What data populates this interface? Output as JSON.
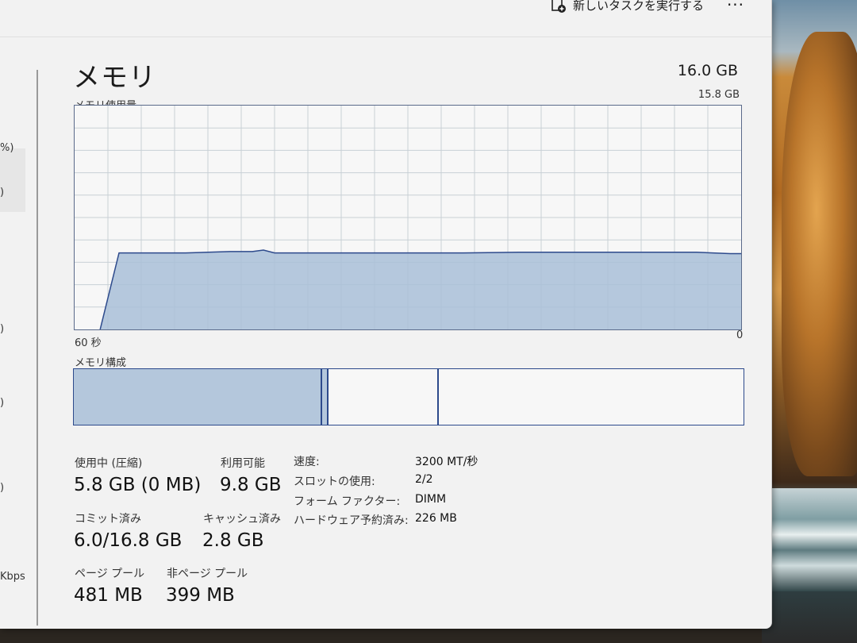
{
  "toolbar": {
    "run_new_task": "新しいタスクを実行する",
    "more_icon": "ellipsis-icon",
    "more_label": "···"
  },
  "sidebar": {
    "fragments": [
      {
        "text": "%)"
      },
      {
        "text": ")"
      },
      {
        "text": ")"
      },
      {
        "text": ")"
      },
      {
        "text": ")"
      },
      {
        "text": "Kbps"
      }
    ]
  },
  "memory": {
    "title": "メモリ",
    "total": "16.0 GB",
    "usage_label": "メモリ使用量",
    "usage_max": "15.8 GB",
    "axis_left": "60 秒",
    "axis_right": "0",
    "composition_label": "メモリ構成"
  },
  "chart_data": {
    "type": "area",
    "x_label_left": "60 秒",
    "x_label_right": "0",
    "ylim": [
      0,
      15.8
    ],
    "grid": true,
    "x": [
      60,
      58,
      57.7,
      56,
      54,
      50,
      46,
      44,
      43,
      42,
      38,
      30,
      25,
      20,
      12,
      10,
      4,
      1,
      0
    ],
    "values": [
      null,
      null,
      0,
      5.4,
      5.4,
      5.4,
      5.5,
      5.5,
      5.6,
      5.4,
      5.4,
      5.4,
      5.4,
      5.45,
      5.45,
      5.45,
      5.45,
      5.35,
      5.35
    ],
    "series": [
      {
        "name": "",
        "values_ref": "values"
      }
    ]
  },
  "composition": {
    "in_use_fraction": 0.37,
    "modified_fraction": 0.007,
    "standby_fraction": 0.163,
    "free_fraction": 0.46
  },
  "stats": {
    "in_use_label": "使用中 (圧縮)",
    "in_use_value": "5.8 GB (0 MB)",
    "available_label": "利用可能",
    "available_value": "9.8 GB",
    "committed_label": "コミット済み",
    "committed_value": "6.0/16.8 GB",
    "cached_label": "キャッシュ済み",
    "cached_value": "2.8 GB",
    "paged_label": "ページ プール",
    "paged_value": "481 MB",
    "nonpaged_label": "非ページ プール",
    "nonpaged_value": "399 MB"
  },
  "details": [
    {
      "key": "速度:",
      "value": "3200 MT/秒"
    },
    {
      "key": "スロットの使用:",
      "value": "2/2"
    },
    {
      "key": "フォーム ファクター:",
      "value": "DIMM"
    },
    {
      "key": "ハードウェア予約済み:",
      "value": "226 MB"
    }
  ],
  "colors": {
    "graph_fill": "#a9bfd8",
    "graph_line": "#2d4a8c",
    "grid": "#c8d0d6",
    "border": "#2d4a8c"
  }
}
